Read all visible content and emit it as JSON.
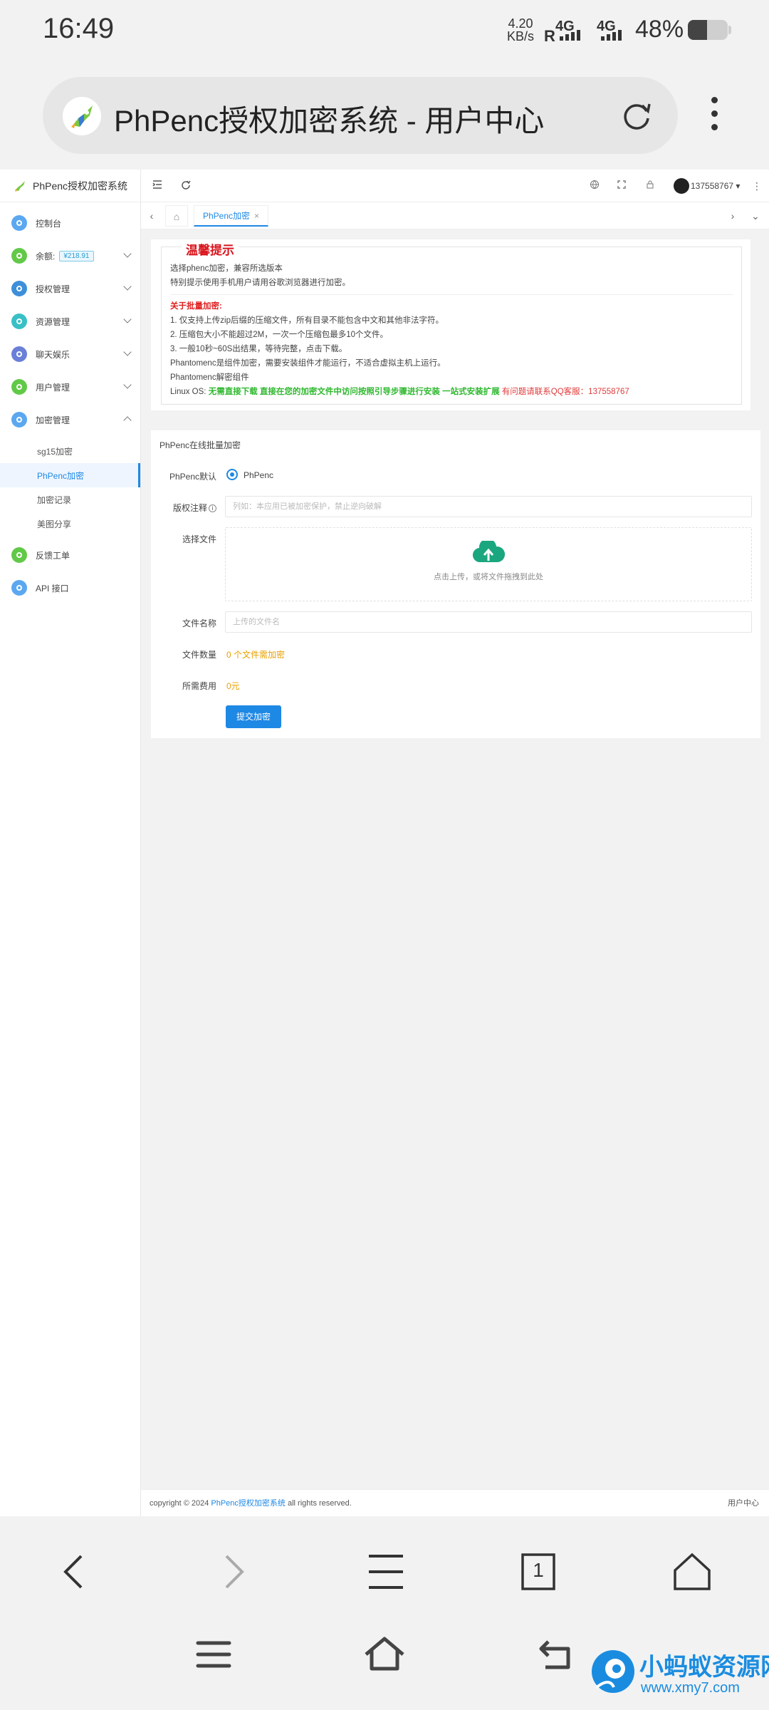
{
  "status_bar": {
    "time": "16:49",
    "net_speed_value": "4.20",
    "net_speed_unit": "KB/s",
    "sim1_label": "4G",
    "sim1_roaming": "R",
    "sim2_label": "4G",
    "battery_text": "48%",
    "battery_level": 0.48
  },
  "browser": {
    "page_title": "PhPenc授权加密系统 - 用户中心"
  },
  "sidebar": {
    "brand": "PhPenc授权加密系统",
    "items": [
      {
        "label": "控制台",
        "color": "#5ba8f0"
      },
      {
        "label": "余额:",
        "color": "#62c948",
        "badge": "¥218.91"
      },
      {
        "label": "授权管理",
        "color": "#3d8fd9"
      },
      {
        "label": "资源管理",
        "color": "#38c0c6"
      },
      {
        "label": "聊天娱乐",
        "color": "#6a7fd8"
      },
      {
        "label": "用户管理",
        "color": "#62c948"
      },
      {
        "label": "加密管理",
        "color": "#5ba8f0"
      },
      {
        "label": "反馈工单",
        "color": "#62c948"
      },
      {
        "label": "API 接口",
        "color": "#5ba8f0"
      }
    ],
    "subitems": [
      "sg15加密",
      "PhPenc加密",
      "加密记录",
      "美图分享"
    ]
  },
  "topbar": {
    "user_name": "137558767"
  },
  "tabs": {
    "active_label": "PhPenc加密",
    "close_glyph": "×"
  },
  "notice": {
    "title": "温馨提示",
    "line1": "选择phenc加密，兼容所选版本",
    "line2": "特别提示使用手机用户请用谷歌浏览器进行加密。",
    "batch_title": "关于批量加密:",
    "batch1": "1. 仅支持上传zip后缀的压缩文件，所有目录不能包含中文和其他非法字符。",
    "batch2": "2. 压缩包大小不能超过2M，一次一个压缩包最多10个文件。",
    "batch3": "3. 一般10秒~60S出结果，等待完整，点击下载。",
    "component1": "Phantomenc是组件加密，需要安装组件才能运行，不适合虚拟主机上运行。",
    "component2": "Phantomenc解密组件",
    "linux_prefix": "Linux OS:",
    "linux_green": "无需直接下载 直接在您的加密文件中访问按照引导步骤进行安装 一站式安装扩展",
    "linux_red": "有问题请联系QQ客服：137558767"
  },
  "form": {
    "title": "PhPenc在线批量加密",
    "mode_label": "PhPenc默认",
    "mode_value": "PhPenc",
    "copyright_label": "版权注释",
    "copyright_placeholder": "列如：本应用已被加密保护，禁止逆向破解",
    "file_label": "选择文件",
    "upload_hint": "点击上传，或将文件拖拽到此处",
    "filename_label": "文件名称",
    "filename_placeholder": "上传的文件名",
    "count_label": "文件数量",
    "count_value": "0 个文件需加密",
    "cost_label": "所需费用",
    "cost_value": "0元",
    "submit_label": "提交加密"
  },
  "footer": {
    "prefix": "copyright © 2024",
    "link": "PhPenc授权加密系统",
    "suffix": "all rights reserved.",
    "right": "用户中心"
  },
  "browser_nav": {
    "tab_count": "1"
  },
  "watermark": {
    "text": "小蚂蚁资源网",
    "url": "www.xmy7.com"
  }
}
